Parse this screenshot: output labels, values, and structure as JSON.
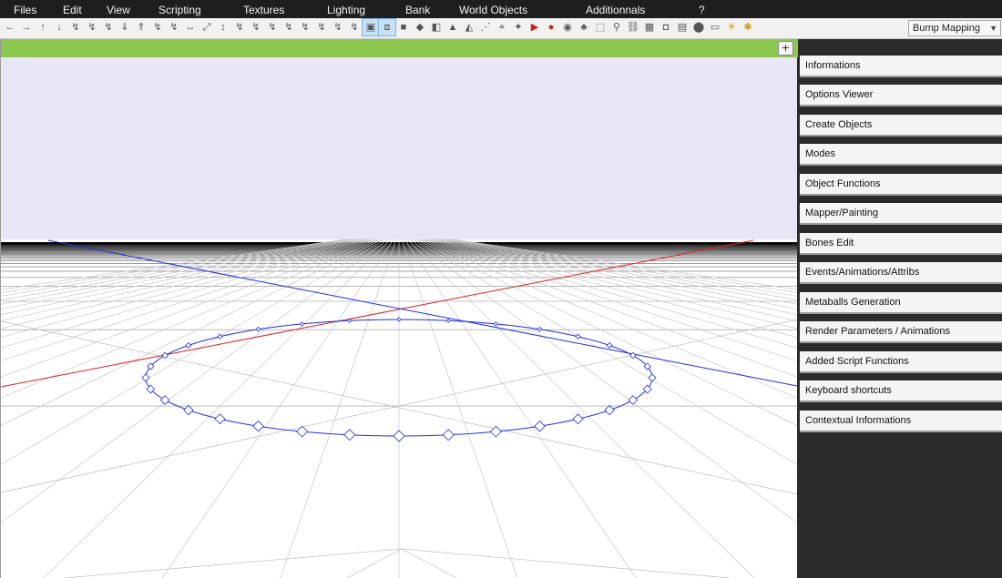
{
  "menu": {
    "items": [
      {
        "label": "Files"
      },
      {
        "label": "Edit"
      },
      {
        "label": "View"
      },
      {
        "label": "Scripting"
      },
      {
        "label": "Textures"
      },
      {
        "label": "Lighting"
      },
      {
        "label": "Bank"
      },
      {
        "label": "World Objects"
      },
      {
        "label": "Additionnals"
      },
      {
        "label": "?"
      }
    ]
  },
  "toolbar": {
    "icons": [
      "arrow-left-icon",
      "arrow-right-icon",
      "arrow-up-icon",
      "arrow-down-icon",
      "rotate-z-icon",
      "rotate-x-icon",
      "rotate-y-icon",
      "move-down-icon",
      "move-up-icon",
      "scale-x-icon",
      "scale-z-icon",
      "move-x-icon",
      "move-xz-icon",
      "move-y-icon",
      "scale-y-icon",
      "scale-yz-icon",
      "slope-icon",
      "slope-2-icon",
      "slope-3-icon",
      "slope-4-icon",
      "slope-5-icon",
      "slope-6-icon",
      "select-box-icon",
      "cube-wire-icon",
      "cube-icon",
      "prism-icon",
      "half-cube-icon",
      "cone-icon",
      "pyramid-icon",
      "vertex-icon",
      "node-icon",
      "light-icon",
      "play-icon",
      "sphere-shaded-icon",
      "object-icon",
      "tree-icon",
      "group-icon",
      "bone-icon",
      "link-icon",
      "texture-icon",
      "camera-icon",
      "film-icon",
      "circle-icon",
      "landscape-icon",
      "lamp-icon",
      "star-icon"
    ],
    "active_icons": [
      22,
      23
    ],
    "mode_select": {
      "value": "Bump Mapping"
    }
  },
  "viewport": {
    "header_color": "#8cc850",
    "sky_color": "#e8e6f6",
    "ground_color": "#ffffff",
    "plus_label": "+"
  },
  "panel": {
    "items": [
      {
        "label": "Informations"
      },
      {
        "label": "Options Viewer"
      },
      {
        "label": "Create Objects"
      },
      {
        "label": "Modes"
      },
      {
        "label": "Object Functions"
      },
      {
        "label": "Mapper/Painting"
      },
      {
        "label": "Bones Edit"
      },
      {
        "label": "Events/Animations/Attribs"
      },
      {
        "label": "Metaballs Generation"
      },
      {
        "label": "Render Parameters / Animations"
      },
      {
        "label": "Added Script Functions"
      },
      {
        "label": "Keyboard shortcuts"
      },
      {
        "label": "Contextual Informations"
      }
    ]
  }
}
